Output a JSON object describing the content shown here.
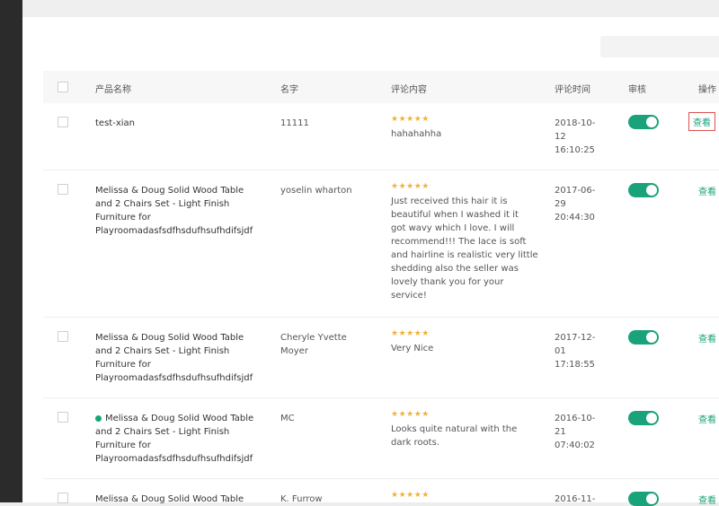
{
  "table": {
    "headers": {
      "product_name": "产品名称",
      "name": "名字",
      "comment": "评论内容",
      "time": "评论时间",
      "review": "审核",
      "action": "操作"
    },
    "rows": [
      {
        "product": [
          "test-xian"
        ],
        "name": [
          "11111"
        ],
        "rating": 5,
        "stars": "★★★★★",
        "comment": [
          "hahahahha"
        ],
        "time": [
          "2018-10-",
          "12",
          "16:10:25"
        ],
        "approved": true,
        "action": "查看"
      },
      {
        "product": [
          "Melissa & Doug Solid Wood Table",
          "and 2 Chairs Set - Light Finish",
          "Furniture for",
          "Playroomadasfsdfhsdufhsufhdifsjdf"
        ],
        "name": [
          "yoselin wharton"
        ],
        "rating": 5,
        "stars": "★★★★★",
        "comment": [
          "Just received this hair it is",
          "beautiful when I washed it it",
          "got wavy which I love. I will",
          "recommend!!! The lace is soft",
          "and hairline is realistic very little",
          "shedding also the seller was",
          "lovely thank you for your",
          "service!"
        ],
        "time": [
          "2017-06-",
          "29",
          "20:44:30"
        ],
        "approved": true,
        "action": "查看"
      },
      {
        "product": [
          "Melissa & Doug Solid Wood Table",
          "and 2 Chairs Set - Light Finish",
          "Furniture for",
          "Playroomadasfsdfhsdufhsufhdifsjdf"
        ],
        "name": [
          "Cheryle Yvette",
          "Moyer"
        ],
        "rating": 5,
        "stars": "★★★★★",
        "comment": [
          "Very Nice"
        ],
        "time": [
          "2017-12-",
          "01",
          "17:18:55"
        ],
        "approved": true,
        "action": "查看"
      },
      {
        "product": [
          "Melissa & Doug Solid Wood Table",
          "and 2 Chairs Set - Light Finish",
          "Furniture for",
          "Playroomadasfsdfhsdufhsufhdifsjdf"
        ],
        "name": [
          "MC"
        ],
        "rating": 5,
        "stars": "★★★★★",
        "comment": [
          "Looks quite natural with the",
          "dark roots."
        ],
        "time": [
          "2016-10-",
          "21",
          "07:40:02"
        ],
        "approved": true,
        "action": "查看"
      },
      {
        "product": [
          "Melissa & Doug Solid Wood Table"
        ],
        "name": [
          "K. Furrow"
        ],
        "rating": 5,
        "stars": "★★★★★",
        "comment": [
          ""
        ],
        "time": [
          "2016-11-"
        ],
        "approved": true,
        "action": "查看"
      }
    ]
  },
  "colors": {
    "accent": "#1aa37a",
    "star": "#f0b23a",
    "highlight_border": "#d9534f"
  }
}
